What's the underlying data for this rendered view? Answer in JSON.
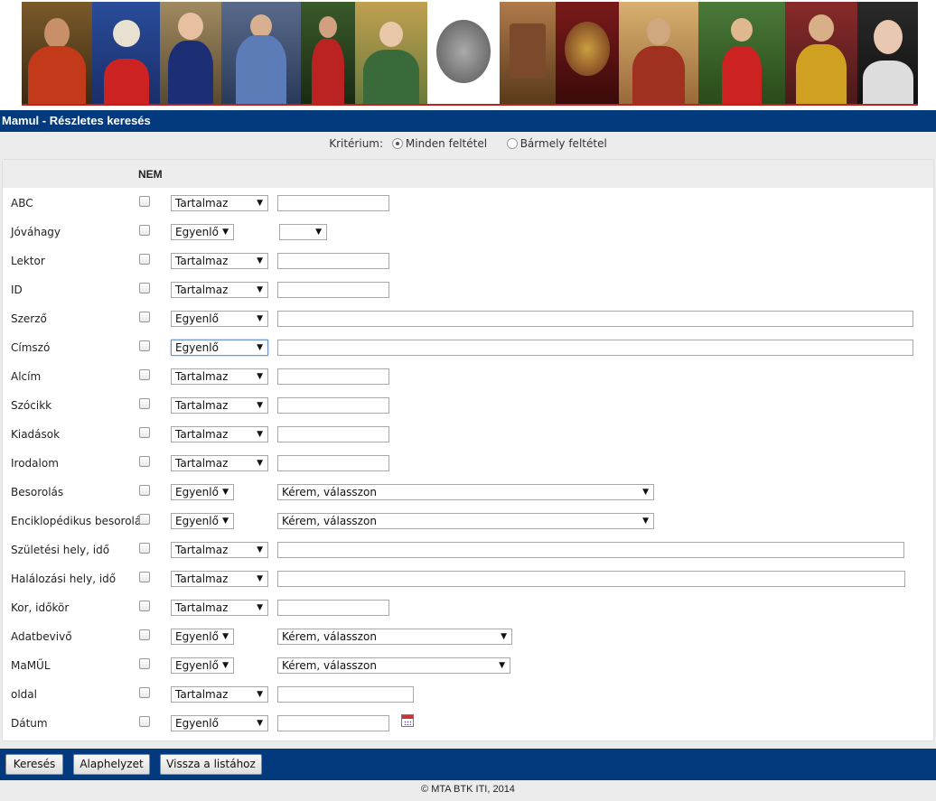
{
  "page_title": "Mamul - Részletes keresés",
  "criteria": {
    "label": "Kritérium:",
    "options": [
      {
        "label": "Minden feltétel",
        "selected": true
      },
      {
        "label": "Bármely feltétel",
        "selected": false
      }
    ]
  },
  "table": {
    "nem_header": "NEM",
    "rows": [
      {
        "label": "ABC",
        "operator": "Tartalmaz",
        "value_type": "text",
        "value": ""
      },
      {
        "label": "Jóváhagy",
        "operator": "Egyenlő",
        "value_type": "select",
        "value": ""
      },
      {
        "label": "Lektor",
        "operator": "Tartalmaz",
        "value_type": "text",
        "value": ""
      },
      {
        "label": "ID",
        "operator": "Tartalmaz",
        "value_type": "text",
        "value": ""
      },
      {
        "label": "Szerző",
        "operator": "Egyenlő",
        "value_type": "text",
        "value": ""
      },
      {
        "label": "Címszó",
        "operator": "Egyenlő",
        "value_type": "text",
        "value": ""
      },
      {
        "label": "Alcím",
        "operator": "Tartalmaz",
        "value_type": "text",
        "value": ""
      },
      {
        "label": "Szócikk",
        "operator": "Tartalmaz",
        "value_type": "text",
        "value": ""
      },
      {
        "label": "Kiadások",
        "operator": "Tartalmaz",
        "value_type": "text",
        "value": ""
      },
      {
        "label": "Irodalom",
        "operator": "Tartalmaz",
        "value_type": "text",
        "value": ""
      },
      {
        "label": "Besorolás",
        "operator": "Egyenlő",
        "value_type": "select",
        "value": "Kérem, válasszon"
      },
      {
        "label": "Enciklopédikus besorolás",
        "operator": "Egyenlő",
        "value_type": "select",
        "value": "Kérem, válasszon"
      },
      {
        "label": "Születési hely, idő",
        "operator": "Tartalmaz",
        "value_type": "text",
        "value": ""
      },
      {
        "label": "Halálozási hely, idő",
        "operator": "Tartalmaz",
        "value_type": "text",
        "value": ""
      },
      {
        "label": "Kor, időkör",
        "operator": "Tartalmaz",
        "value_type": "text",
        "value": ""
      },
      {
        "label": "Adatbevivő",
        "operator": "Egyenlő",
        "value_type": "select",
        "value": "Kérem, válasszon"
      },
      {
        "label": "MaMŰL",
        "operator": "Egyenlő",
        "value_type": "select",
        "value": "Kérem, válasszon"
      },
      {
        "label": "oldal",
        "operator": "Tartalmaz",
        "value_type": "text",
        "value": ""
      },
      {
        "label": "Dátum",
        "operator": "Egyenlő",
        "value_type": "date",
        "value": ""
      }
    ]
  },
  "buttons": {
    "search": "Keresés",
    "reset": "Alaphelyzet",
    "back": "Vissza a listához"
  },
  "footer": "© MTA BTK ITI, 2014",
  "colors": {
    "bar_blue": "#023a7d",
    "banner_red": "#b22222"
  },
  "icons": {
    "date_picker": "calendar-icon",
    "dropdown": "triangle-down"
  }
}
